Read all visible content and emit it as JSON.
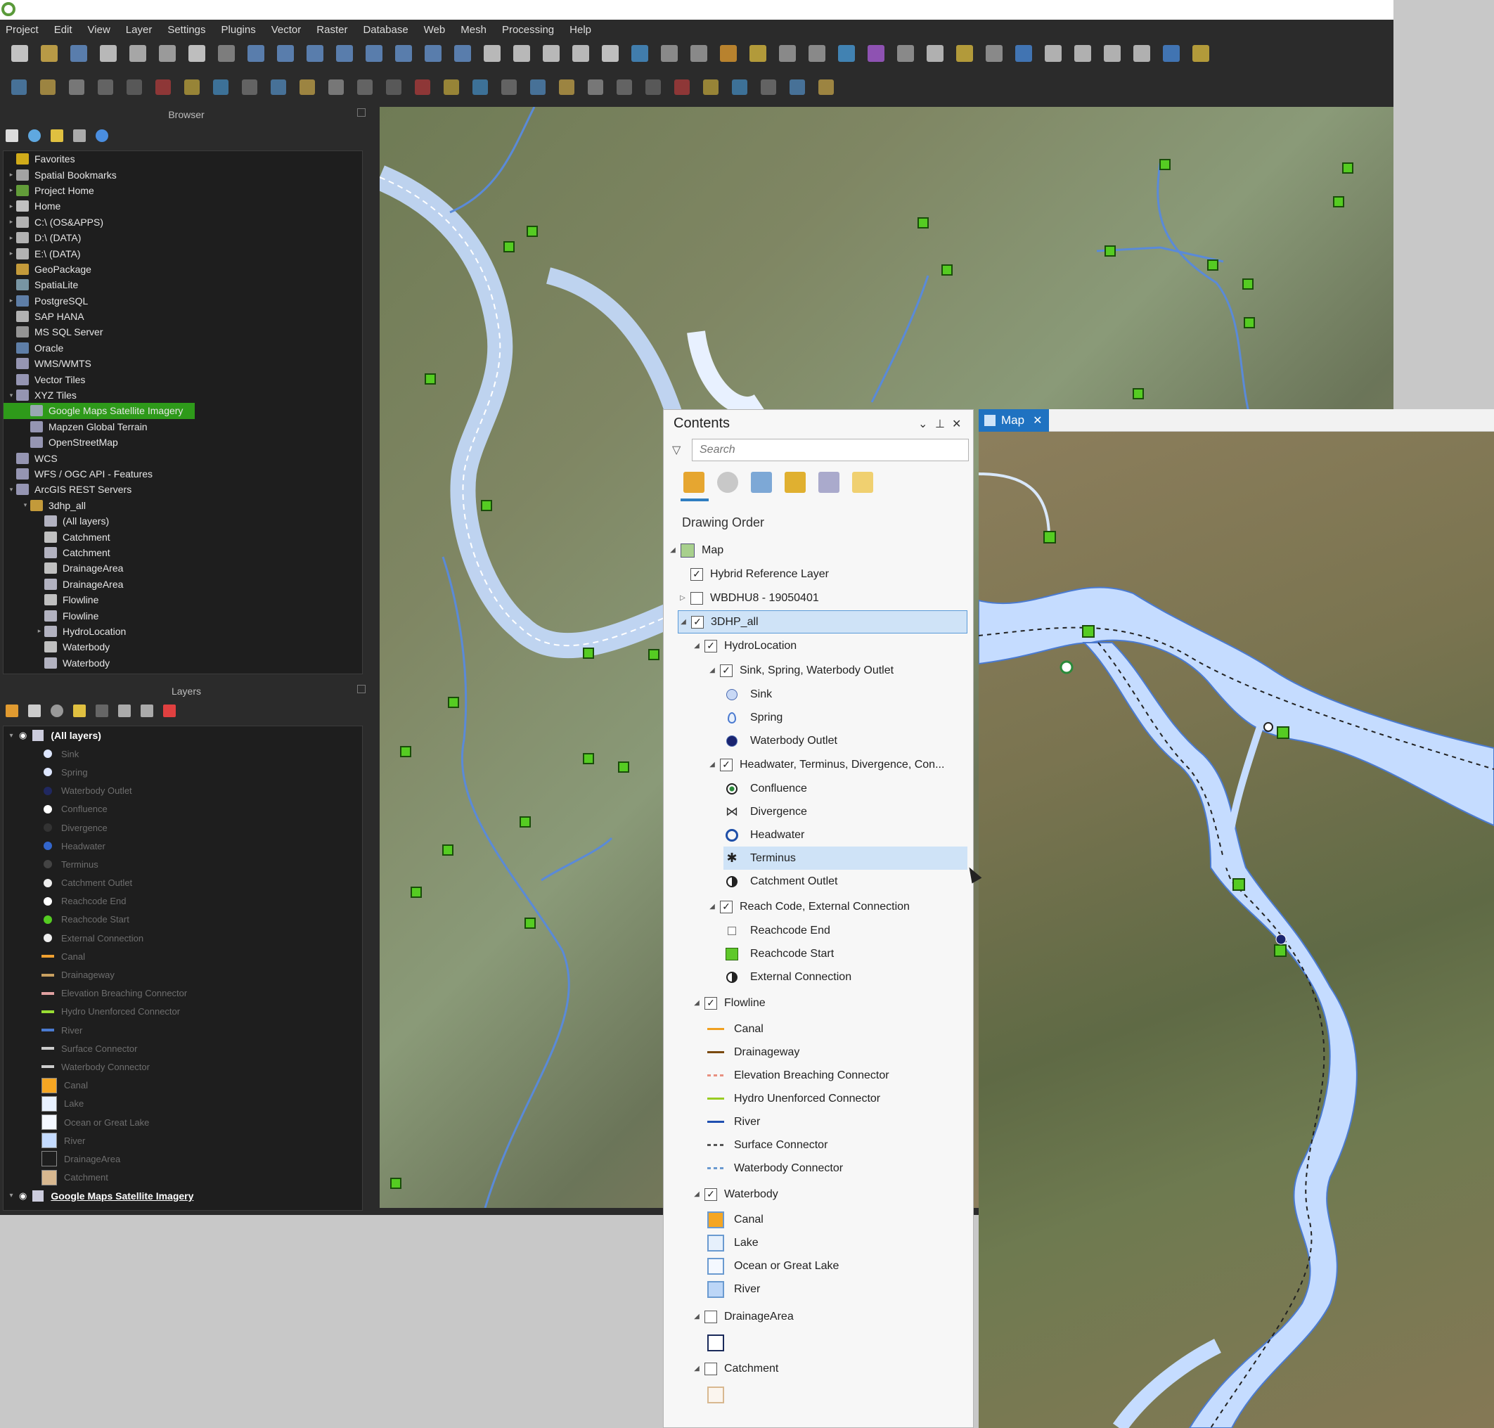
{
  "qgis": {
    "menu": [
      "Project",
      "Edit",
      "View",
      "Layer",
      "Settings",
      "Plugins",
      "Vector",
      "Raster",
      "Database",
      "Web",
      "Mesh",
      "Processing",
      "Help"
    ],
    "browser_title": "Browser",
    "layers_title": "Layers",
    "browser_items": [
      {
        "label": "Favorites",
        "icon": "star-icon",
        "color": "#f0c419",
        "indent": 0,
        "arrow": ""
      },
      {
        "label": "Spatial Bookmarks",
        "icon": "bookmark-icon",
        "color": "#bbb",
        "indent": 0,
        "arrow": "▸"
      },
      {
        "label": "Project Home",
        "icon": "project-home-icon",
        "color": "#6fb33e",
        "indent": 0,
        "arrow": "▸"
      },
      {
        "label": "Home",
        "icon": "home-icon",
        "color": "#ddd",
        "indent": 0,
        "arrow": "▸"
      },
      {
        "label": "C:\\ (OS&APPS)",
        "icon": "folder-icon",
        "color": "#ccc",
        "indent": 0,
        "arrow": "▸"
      },
      {
        "label": "D:\\ (DATA)",
        "icon": "folder-icon",
        "color": "#ccc",
        "indent": 0,
        "arrow": "▸"
      },
      {
        "label": "E:\\ (DATA)",
        "icon": "folder-icon",
        "color": "#ccc",
        "indent": 0,
        "arrow": "▸"
      },
      {
        "label": "GeoPackage",
        "icon": "geopackage-icon",
        "color": "#e0b040",
        "indent": 0,
        "arrow": ""
      },
      {
        "label": "SpatiaLite",
        "icon": "spatialite-icon",
        "color": "#8ab",
        "indent": 0,
        "arrow": ""
      },
      {
        "label": "PostgreSQL",
        "icon": "postgresql-icon",
        "color": "#6a8fc0",
        "indent": 0,
        "arrow": "▸"
      },
      {
        "label": "SAP HANA",
        "icon": "sap-hana-icon",
        "color": "#ccc",
        "indent": 0,
        "arrow": ""
      },
      {
        "label": "MS SQL Server",
        "icon": "mssql-icon",
        "color": "#aaa",
        "indent": 0,
        "arrow": ""
      },
      {
        "label": "Oracle",
        "icon": "oracle-icon",
        "color": "#6a8fc0",
        "indent": 0,
        "arrow": ""
      },
      {
        "label": "WMS/WMTS",
        "icon": "wms-icon",
        "color": "#aac",
        "indent": 0,
        "arrow": ""
      },
      {
        "label": "Vector Tiles",
        "icon": "vector-tiles-icon",
        "color": "#aac",
        "indent": 0,
        "arrow": ""
      },
      {
        "label": "XYZ Tiles",
        "icon": "xyz-tiles-icon",
        "color": "#aac",
        "indent": 0,
        "arrow": "▾"
      },
      {
        "label": "Google Maps Satellite Imagery",
        "icon": "xyz-layer-icon",
        "color": "#aac",
        "indent": 1,
        "arrow": "",
        "selected": true
      },
      {
        "label": "Mapzen Global Terrain",
        "icon": "xyz-layer-icon",
        "color": "#aac",
        "indent": 1,
        "arrow": ""
      },
      {
        "label": "OpenStreetMap",
        "icon": "xyz-layer-icon",
        "color": "#aac",
        "indent": 1,
        "arrow": ""
      },
      {
        "label": "WCS",
        "icon": "wcs-icon",
        "color": "#aac",
        "indent": 0,
        "arrow": ""
      },
      {
        "label": "WFS / OGC API - Features",
        "icon": "wfs-icon",
        "color": "#aac",
        "indent": 0,
        "arrow": ""
      },
      {
        "label": "ArcGIS REST Servers",
        "icon": "arcgis-rest-icon",
        "color": "#aac",
        "indent": 0,
        "arrow": "▾"
      },
      {
        "label": "3dhp_all",
        "icon": "service-icon",
        "color": "#e0b040",
        "indent": 1,
        "arrow": "▾"
      },
      {
        "label": "(All layers)",
        "icon": "layer-group-icon",
        "color": "#ccd",
        "indent": 2,
        "arrow": ""
      },
      {
        "label": "Catchment",
        "icon": "polygon-layer-icon",
        "color": "#ddd",
        "indent": 2,
        "arrow": ""
      },
      {
        "label": "Catchment",
        "icon": "layer-group-icon",
        "color": "#ccd",
        "indent": 2,
        "arrow": ""
      },
      {
        "label": "DrainageArea",
        "icon": "polygon-layer-icon",
        "color": "#ddd",
        "indent": 2,
        "arrow": ""
      },
      {
        "label": "DrainageArea",
        "icon": "layer-group-icon",
        "color": "#ccd",
        "indent": 2,
        "arrow": ""
      },
      {
        "label": "Flowline",
        "icon": "line-layer-icon",
        "color": "#ddd",
        "indent": 2,
        "arrow": ""
      },
      {
        "label": "Flowline",
        "icon": "layer-group-icon",
        "color": "#ccd",
        "indent": 2,
        "arrow": ""
      },
      {
        "label": "HydroLocation",
        "icon": "layer-group-icon",
        "color": "#ccd",
        "indent": 2,
        "arrow": "▸"
      },
      {
        "label": "Waterbody",
        "icon": "polygon-layer-icon",
        "color": "#ddd",
        "indent": 2,
        "arrow": ""
      },
      {
        "label": "Waterbody",
        "icon": "layer-group-icon",
        "color": "#ccd",
        "indent": 2,
        "arrow": ""
      }
    ],
    "layers_header": "(All layers)",
    "legend": [
      {
        "label": "Sink",
        "icon": "sink-icon",
        "color": "#dde6ff"
      },
      {
        "label": "Spring",
        "icon": "spring-icon",
        "color": "#dde6ff"
      },
      {
        "label": "Waterbody Outlet",
        "icon": "waterbody-outlet-icon",
        "color": "#202860"
      },
      {
        "label": "Confluence",
        "icon": "confluence-icon",
        "color": "#ffffff"
      },
      {
        "label": "Divergence",
        "icon": "divergence-icon",
        "color": "#333"
      },
      {
        "label": "Headwater",
        "icon": "headwater-icon",
        "color": "#3366cc"
      },
      {
        "label": "Terminus",
        "icon": "terminus-icon",
        "color": "#444"
      },
      {
        "label": "Catchment Outlet",
        "icon": "catchment-outlet-icon",
        "color": "#eee"
      },
      {
        "label": "Reachcode End",
        "icon": "reachcode-end-icon",
        "color": "#fff"
      },
      {
        "label": "Reachcode Start",
        "icon": "reachcode-start-icon",
        "color": "#55cc22"
      },
      {
        "label": "External Connection",
        "icon": "external-connection-icon",
        "color": "#eee"
      },
      {
        "label": "Canal",
        "icon": "canal-line-icon",
        "color": "#f0a030"
      },
      {
        "label": "Drainageway",
        "icon": "drainageway-line-icon",
        "color": "#c8a060"
      },
      {
        "label": "Elevation Breaching Connector",
        "icon": "elevation-breaching-line-icon",
        "color": "#e0a0a0"
      },
      {
        "label": "Hydro Unenforced Connector",
        "icon": "hydro-unenforced-line-icon",
        "color": "#99dd33"
      },
      {
        "label": "River",
        "icon": "river-line-icon",
        "color": "#4a7ad0"
      },
      {
        "label": "Surface Connector",
        "icon": "surface-connector-line-icon",
        "color": "#ccc"
      },
      {
        "label": "Waterbody Connector",
        "icon": "waterbody-connector-line-icon",
        "color": "#ccc"
      },
      {
        "label": "Canal",
        "icon": "canal-fill-icon",
        "color": "#f5a623"
      },
      {
        "label": "Lake",
        "icon": "lake-fill-icon",
        "color": "#e8f1ff"
      },
      {
        "label": "Ocean or Great Lake",
        "icon": "ocean-fill-icon",
        "color": "#f4f8ff"
      },
      {
        "label": "River",
        "icon": "river-fill-icon",
        "color": "#c5dcff"
      },
      {
        "label": "DrainageArea",
        "icon": "drainagearea-fill-icon",
        "color": "#1e1e1e"
      },
      {
        "label": "Catchment",
        "icon": "catchment-fill-icon",
        "color": "#d8b890"
      }
    ],
    "layers_footer": "Google Maps Satellite Imagery"
  },
  "arcgis": {
    "contents_title": "Contents",
    "search_placeholder": "Search",
    "drawing_order": "Drawing Order",
    "map_tab": "Map",
    "tree": [
      {
        "label": "Map",
        "level": 0,
        "type": "map",
        "twisty": "◢"
      },
      {
        "label": "Hybrid Reference Layer",
        "level": 1,
        "type": "check",
        "checked": true
      },
      {
        "label": "WBDHU8 - 19050401",
        "level": 1,
        "type": "check",
        "checked": false,
        "twisty": "▷"
      },
      {
        "label": "3DHP_all",
        "level": 1,
        "type": "check",
        "checked": true,
        "twisty": "◢",
        "selected": true
      },
      {
        "label": "HydroLocation",
        "level": 2,
        "type": "check",
        "checked": true,
        "twisty": "◢"
      },
      {
        "label": "Sink, Spring, Waterbody Outlet",
        "level": 3,
        "type": "check",
        "checked": true,
        "twisty": "◢"
      },
      {
        "label": "Sink",
        "level": 4,
        "type": "sym",
        "icon": "sink-icon",
        "color": "#c8d8f5"
      },
      {
        "label": "Spring",
        "level": 4,
        "type": "sym",
        "icon": "spring-icon",
        "color": "#c8d8f5"
      },
      {
        "label": "Waterbody Outlet",
        "level": 4,
        "type": "sym",
        "icon": "waterbody-outlet-icon",
        "color": "#1a2470"
      },
      {
        "label": "Headwater, Terminus, Divergence, Con...",
        "level": 3,
        "type": "check",
        "checked": true,
        "twisty": "◢"
      },
      {
        "label": "Confluence",
        "level": 4,
        "type": "sym",
        "icon": "confluence-icon",
        "color": "#2a8a3a"
      },
      {
        "label": "Divergence",
        "level": 4,
        "type": "sym",
        "icon": "divergence-icon",
        "color": "#333"
      },
      {
        "label": "Headwater",
        "level": 4,
        "type": "sym",
        "icon": "headwater-icon",
        "color": "#1f4fa8"
      },
      {
        "label": "Terminus",
        "level": 4,
        "type": "sym",
        "icon": "terminus-icon",
        "color": "#222",
        "selected": true
      },
      {
        "label": "Catchment Outlet",
        "level": 4,
        "type": "sym",
        "icon": "catchment-outlet-icon",
        "color": "#222"
      },
      {
        "label": "Reach Code, External Connection",
        "level": 3,
        "type": "check",
        "checked": true,
        "twisty": "◢"
      },
      {
        "label": "Reachcode End",
        "level": 4,
        "type": "sym",
        "icon": "reachcode-end-icon",
        "color": "#fff"
      },
      {
        "label": "Reachcode Start",
        "level": 4,
        "type": "sym",
        "icon": "reachcode-start-icon",
        "color": "#5fc82a"
      },
      {
        "label": "External Connection",
        "level": 4,
        "type": "sym",
        "icon": "external-connection-icon",
        "color": "#222"
      },
      {
        "label": "Flowline",
        "level": 2,
        "type": "check",
        "checked": true,
        "twisty": "◢"
      },
      {
        "label": "Canal",
        "level": 3,
        "type": "sym",
        "icon": "canal-line-icon",
        "color": "#f0a020"
      },
      {
        "label": "Drainageway",
        "level": 3,
        "type": "sym",
        "icon": "drainageway-line-icon",
        "color": "#7a4a10"
      },
      {
        "label": "Elevation Breaching Connector",
        "level": 3,
        "type": "sym",
        "icon": "elevation-breaching-line-icon",
        "color": "#e89080"
      },
      {
        "label": "Hydro Unenforced Connector",
        "level": 3,
        "type": "sym",
        "icon": "hydro-unenforced-line-icon",
        "color": "#99cc22"
      },
      {
        "label": "River",
        "level": 3,
        "type": "sym",
        "icon": "river-line-icon",
        "color": "#1f4fb0"
      },
      {
        "label": "Surface Connector",
        "level": 3,
        "type": "sym",
        "icon": "surface-connector-line-icon",
        "color": "#555"
      },
      {
        "label": "Waterbody Connector",
        "level": 3,
        "type": "sym",
        "icon": "waterbody-connector-line-icon",
        "color": "#6a9ad0"
      },
      {
        "label": "Waterbody",
        "level": 2,
        "type": "check",
        "checked": true,
        "twisty": "◢"
      },
      {
        "label": "Canal",
        "level": 3,
        "type": "sym",
        "icon": "canal-fill-icon",
        "color": "#f5a623"
      },
      {
        "label": "Lake",
        "level": 3,
        "type": "sym",
        "icon": "lake-fill-icon",
        "color": "#e6f0fc"
      },
      {
        "label": "Ocean or Great Lake",
        "level": 3,
        "type": "sym",
        "icon": "ocean-fill-icon",
        "color": "#f4f8ff"
      },
      {
        "label": "River",
        "level": 3,
        "type": "sym",
        "icon": "river-fill-icon",
        "color": "#bcd6f7"
      },
      {
        "label": "DrainageArea",
        "level": 2,
        "type": "check",
        "checked": false,
        "twisty": "◢"
      },
      {
        "label": "",
        "level": 3,
        "type": "sym",
        "icon": "drainagearea-fill-icon",
        "color": "#ffffff"
      },
      {
        "label": "Catchment",
        "level": 2,
        "type": "check",
        "checked": false,
        "twisty": "◢"
      },
      {
        "label": "",
        "level": 3,
        "type": "sym",
        "icon": "catchment-fill-icon",
        "color": "#fbf5ee"
      }
    ]
  }
}
